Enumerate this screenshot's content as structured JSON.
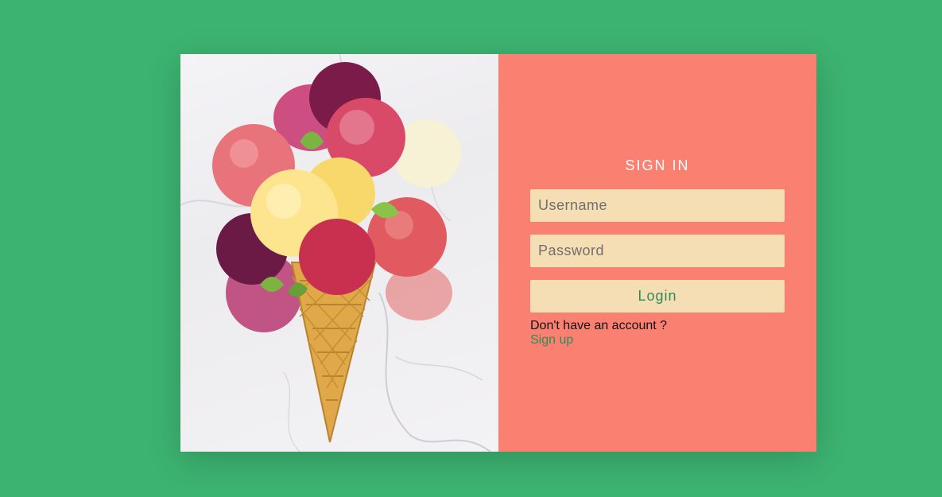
{
  "hero_image": {
    "subject": "ice cream scoops in a waffle cone on marble"
  },
  "form": {
    "title": "SIGN IN",
    "username_placeholder": "Username",
    "password_placeholder": "Password",
    "login_label": "Login",
    "no_account_text": "Don't have an account ?",
    "signup_label": "Sign up"
  },
  "colors": {
    "background": "#3cb371",
    "form_panel": "#fa8072",
    "field": "#f5deb3",
    "accent": "#2e8b57"
  }
}
